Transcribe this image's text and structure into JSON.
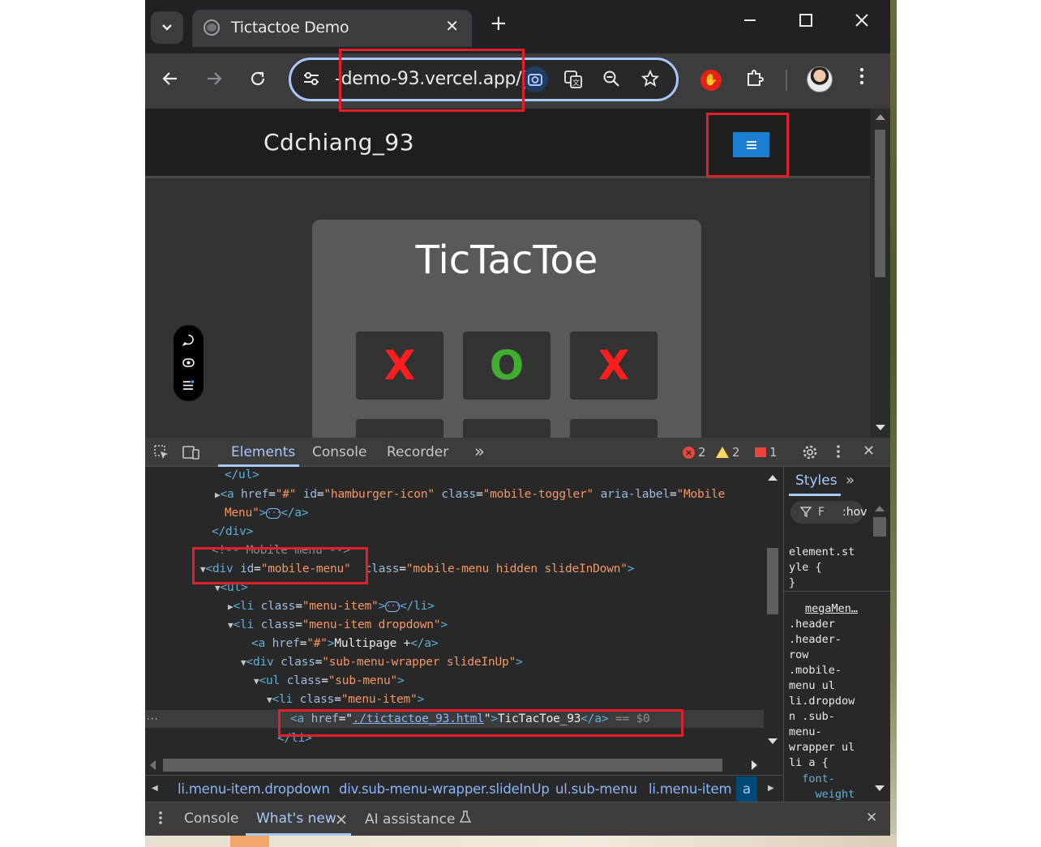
{
  "browser": {
    "tab_title": "Tictactoe Demo",
    "tab_close": "✕",
    "new_tab": "+",
    "url": "-demo-93.vercel.app/",
    "url_caret": "|"
  },
  "page": {
    "brand": "Cdchiang_93",
    "menu_icon": "≡",
    "game_title": "TicTacToe",
    "board": [
      "X",
      "O",
      "X",
      "",
      "",
      ""
    ]
  },
  "devtools": {
    "tabs": [
      "Elements",
      "Console",
      "Recorder"
    ],
    "more_tabs": "»",
    "errors": "2",
    "warnings": "2",
    "issues": "1",
    "close": "✕",
    "styles_tab": "Styles",
    "styles_more": "»",
    "filter_placeholder": "F",
    "hov": ":hov",
    "element_style": "element.st\nyle {\n}",
    "rule_source": "megaMen…",
    "rule_selector": ".header\n.header-\nrow\n.mobile-\nmenu ul\nli.dropdow\nn .sub-\nmenu-\nwrapper ul\nli a {",
    "rule_prop": "  font-\n    weight",
    "dom": {
      "l1_close_ul": "</ul>",
      "l2_a_open": "<a",
      "l2_href_attr": "href",
      "l2_href_val": "\"#\"",
      "l2_id_attr": "id",
      "l2_id_val": "\"hamburger-icon\"",
      "l2_class_attr": "class",
      "l2_class_val": "\"mobile-toggler\"",
      "l2_aria_attr": "aria-label",
      "l2_aria_val": "\"Mobile",
      "l3_aria_val_cont": "Menu\"",
      "l3_close": "</a>",
      "l4_close_div": "</div>",
      "l5_comment": "<!-- Mobile menu -->",
      "l6_div_open": "<div",
      "l6_id_attr": "id",
      "l6_id_val": "\"mobile-menu\"",
      "l6_class_attr": "class",
      "l6_class_val": "\"mobile-menu hidden slideInDown\"",
      "l7_ul": "<ul>",
      "l8_li": "<li",
      "l8_class_attr": "class",
      "l8_class_val": "\"menu-item\"",
      "l8_close": "</li>",
      "l9_li": "<li",
      "l9_class_attr": "class",
      "l9_class_val": "\"menu-item dropdown\"",
      "l10_a": "<a",
      "l10_href_attr": "href",
      "l10_href_val": "\"#\"",
      "l10_text": "Multipage +",
      "l10_close": "</a>",
      "l11_div": "<div",
      "l11_class_attr": "class",
      "l11_class_val": "\"sub-menu-wrapper slideInUp\"",
      "l12_ul": "<ul",
      "l12_class_attr": "class",
      "l12_class_val": "\"sub-menu\"",
      "l13_li": "<li",
      "l13_class_attr": "class",
      "l13_class_val": "\"menu-item\"",
      "l14_a": "<a",
      "l14_href_attr": "href",
      "l14_href_val": "./tictactoe_93.html",
      "l14_text": "TicTacToe_93",
      "l14_close": "</a>",
      "l14_eq": "== $0",
      "l15_close_li": "</li>",
      "dots": "···"
    },
    "breadcrumbs": [
      "li.menu-item.dropdown",
      "div.sub-menu-wrapper.slideInUp",
      "ul.sub-menu",
      "li.menu-item",
      "a"
    ]
  },
  "drawer": {
    "items": [
      "Console",
      "What's new",
      "AI assistance"
    ],
    "close": "✕"
  },
  "colors": {
    "annotation": "#e0202a",
    "x_mark": "#ff1e1e",
    "o_mark": "#3fae2f",
    "menu_button": "#1a7fd0"
  }
}
